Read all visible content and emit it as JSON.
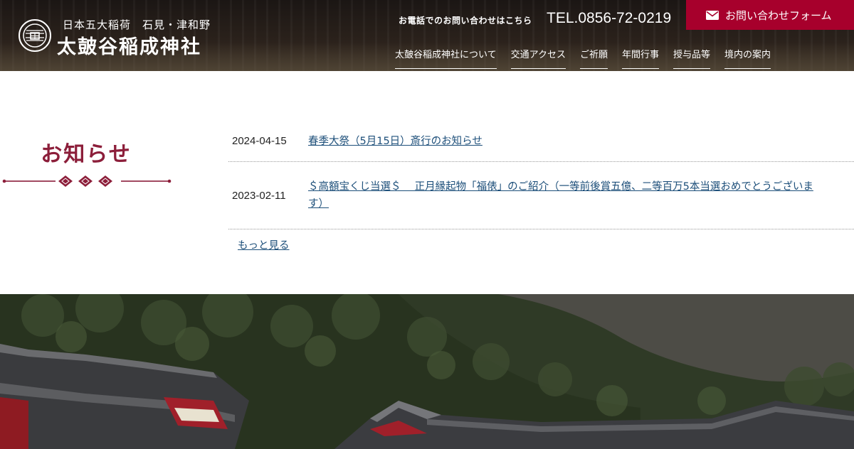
{
  "header": {
    "logo_sub": "日本五大稲荷　石見・津和野",
    "logo_name": "太皷谷稲成神社",
    "logo_icon": "shrine-crest-icon",
    "tel_note": "お電話でのお問い合わせはこちら",
    "tel_number": "TEL.0856-72-0219",
    "contact_label": "お問い合わせフォーム",
    "contact_icon": "envelope-icon",
    "accent_color": "#a7002c",
    "nav": [
      {
        "label": "太皷谷稲成神社について"
      },
      {
        "label": "交通アクセス"
      },
      {
        "label": "ご祈願"
      },
      {
        "label": "年間行事"
      },
      {
        "label": "授与品等"
      },
      {
        "label": "境内の案内"
      }
    ]
  },
  "news": {
    "title": "お知らせ",
    "title_color": "#8c1e3a",
    "items": [
      {
        "date": "2024-04-15",
        "lines": [
          "春季大祭（5月15日）斎行のお知らせ"
        ]
      },
      {
        "date": "2023-02-11",
        "lines": [
          "＄高額宝くじ当選＄　 正月縁起物「福俵」のご紹介（一等前後賞五億、二等百万5本当選おめでとうございま",
          "す）"
        ]
      }
    ],
    "more_label": "もっと見る"
  }
}
